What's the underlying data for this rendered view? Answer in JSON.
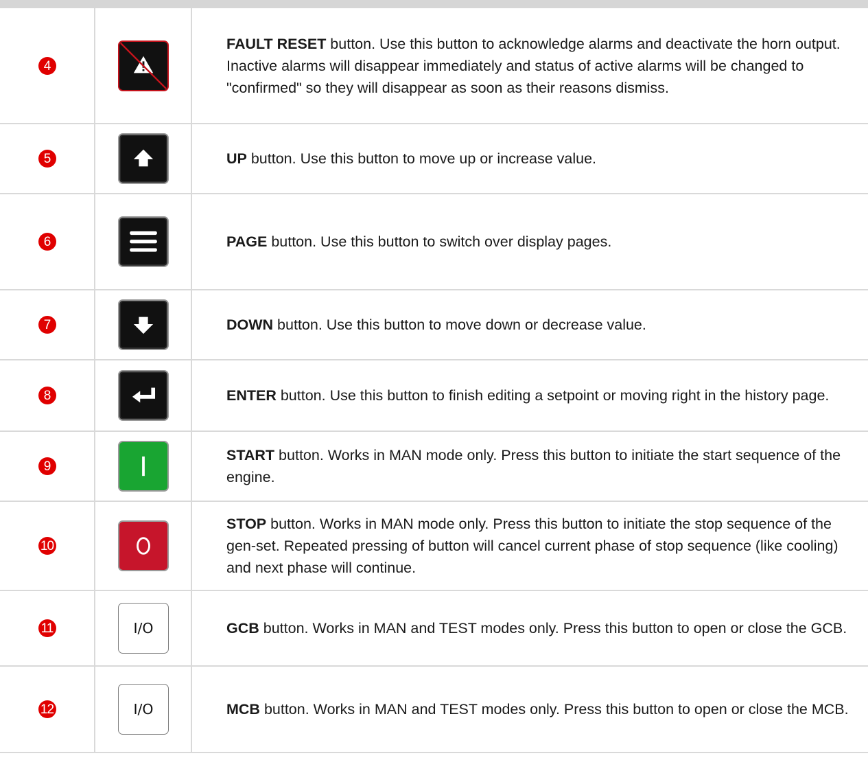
{
  "rows": [
    {
      "num": "4",
      "icon": "fault-reset-icon",
      "keyword": "FAULT RESET",
      "text": " button. Use this button to acknowledge alarms and deactivate the horn output. Inactive alarms will disappear immediately and status of active alarms will be changed to \"confirmed\" so they will disappear as soon as their reasons dismiss."
    },
    {
      "num": "5",
      "icon": "up-arrow-icon",
      "keyword": "UP",
      "text": " button. Use this button to move up or increase value."
    },
    {
      "num": "6",
      "icon": "page-menu-icon",
      "keyword": "PAGE",
      "text": " button. Use this button to switch over display pages."
    },
    {
      "num": "7",
      "icon": "down-arrow-icon",
      "keyword": "DOWN",
      "text": " button. Use this button to move down or decrease value."
    },
    {
      "num": "8",
      "icon": "enter-icon",
      "keyword": "ENTER",
      "text": " button. Use this button to finish editing a setpoint or moving right in the history page."
    },
    {
      "num": "9",
      "icon": "start-icon",
      "keyword": "START",
      "text": " button. Works in MAN mode only. Press this button to initiate the start sequence of the engine."
    },
    {
      "num": "10",
      "icon": "stop-icon",
      "keyword": "STOP",
      "text": " button. Works in MAN mode only. Press this button to initiate the stop sequence of the gen-set. Repeated pressing of button will cancel current phase of stop sequence (like cooling) and next phase will continue."
    },
    {
      "num": "11",
      "icon": "gcb-toggle-icon",
      "icon_text": "I/O",
      "keyword": "GCB",
      "text": " button. Works in MAN and TEST modes only. Press this button to open or close the GCB."
    },
    {
      "num": "12",
      "icon": "mcb-toggle-icon",
      "icon_text": "I/O",
      "keyword": "MCB",
      "text": " button. Works in MAN and TEST modes only. Press this button to open or close the MCB."
    }
  ],
  "colors": {
    "badge": "#e00000",
    "start_green": "#19a532",
    "stop_red": "#c6152b",
    "fault_red": "#c4131c"
  }
}
